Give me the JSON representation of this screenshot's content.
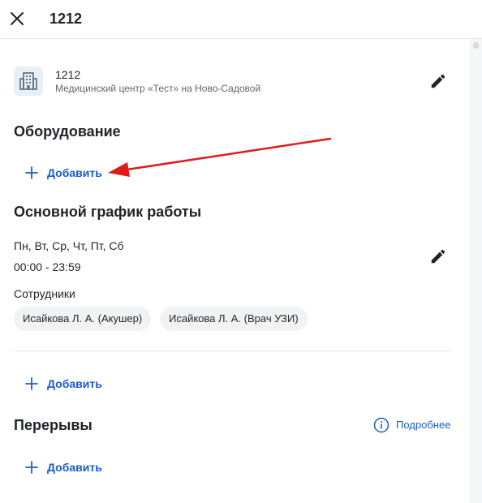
{
  "header": {
    "title": "1212"
  },
  "organization": {
    "name": "1212",
    "address": "Медицинский центр «Тест» на Ново-Садовой"
  },
  "equipment": {
    "title": "Оборудование",
    "add_label": "Добавить"
  },
  "schedule": {
    "title": "Основной график работы",
    "days": "Пн, Вт, Ср, Чт, Пт, Сб",
    "hours": "00:00 - 23:59",
    "staff_label": "Сотрудники",
    "staff": [
      "Исайкова Л. А. (Акушер)",
      "Исайкова Л. А. (Врач УЗИ)"
    ],
    "add_label": "Добавить"
  },
  "breaks": {
    "title": "Перерывы",
    "more_label": "Подробнее",
    "add_label": "Добавить"
  },
  "colors": {
    "accent": "#1b5cc9",
    "annotation_arrow": "#e01b1b"
  },
  "icons": {
    "close": "close-icon",
    "building": "building-icon",
    "edit": "pencil-icon",
    "add": "plus-icon",
    "info": "info-icon"
  }
}
